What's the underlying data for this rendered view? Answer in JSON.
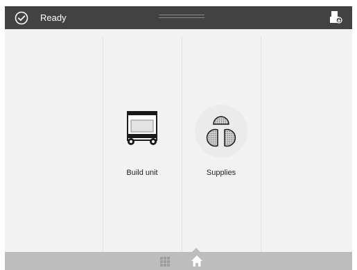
{
  "topbar": {
    "status_text": "Ready",
    "status_icon": "check-circle-icon",
    "tray_icon": "output-tray-icon"
  },
  "tiles": [
    {
      "label": "Build unit",
      "icon": "build-unit-icon"
    },
    {
      "label": "Supplies",
      "icon": "supplies-icon"
    }
  ],
  "bottombar": {
    "apps_icon": "apps-grid-icon",
    "home_icon": "home-icon",
    "active": "home"
  },
  "colors": {
    "topbar": "#424242",
    "background": "#f2f2f2",
    "bottombar": "#bdbdbd",
    "icon_active": "#ffffff",
    "icon_inactive": "#9e9e9e"
  }
}
